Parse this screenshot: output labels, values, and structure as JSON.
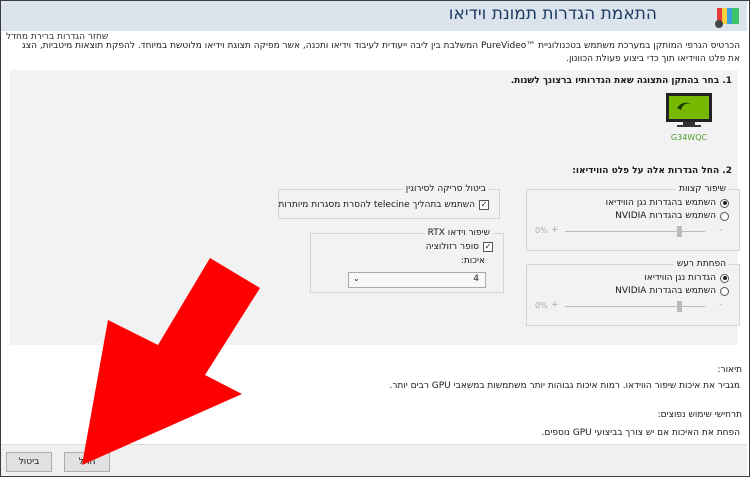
{
  "header": {
    "title": "התאמת הגדרות תמונת וידיאו",
    "restore_link": "שחזר הגדרות ברירת מחדל"
  },
  "description": "הכרטיס הגרפי המותקן במערכת משתמש בטכנולוגיית ™PureVideo המשלבת בין ליבה ייעודית לעיבוד וידיאו ותכנה, אשר מפיקה תצוגת וידיאו מלוטשת במיוחד. להפקת תוצאות מיטביות, הצג את פלט הווידיאו תוך כדי ביצוע פעולת הכוונון.",
  "step1": {
    "label": "1. בחר בהתקן התצוגה שאת הגדרותיו ברצונך לשנות.",
    "monitor_name": "G34WQC"
  },
  "step2": {
    "label": "2. החל הגדרות אלה על פלט הווידיאו:"
  },
  "edge_enhancement": {
    "title": "שיפור קצוות",
    "option_player": "השתמש בהגדרות נגן הווידיאו",
    "option_nvidia": "השתמש בהגדרות NVIDIA",
    "value": "0%",
    "selected": "option_player"
  },
  "noise_reduction": {
    "title": "הפחתת רעש",
    "option_player": "הגדרות נגן הווידיאו",
    "option_nvidia": "השתמש בהגדרות NVIDIA",
    "value": "0%",
    "selected": "option_player"
  },
  "deinterlacing": {
    "title": "ביטול סריקה לסירוגין",
    "checkbox_label": "השתמש בתהליך telecine להסרת מסגרות מיותרות",
    "checked": true
  },
  "rtx_video": {
    "title": "שיפור וידאו RTX",
    "checkbox_label": "סופר רזולוציה",
    "checked": true,
    "quality_label": "איכות:",
    "quality_value": "4"
  },
  "info": {
    "description_heading": "תיאור:",
    "description_text": "מגביר את איכות שיפור הווידאו. רמות איכות גבוהות יותר משתמשות במשאבי GPU רבים יותר.",
    "usage_heading": "תרחישי שימוש נפוצים:",
    "usage_text": "הפחת את האיכות אם יש צורך בביצועי GPU נוספים."
  },
  "footer": {
    "apply_label": "החל",
    "cancel_label": "ביטול"
  },
  "colors": {
    "title_blue": "#1e3b63",
    "nvidia_green": "#76b900",
    "arrow_red": "#ff0000"
  }
}
